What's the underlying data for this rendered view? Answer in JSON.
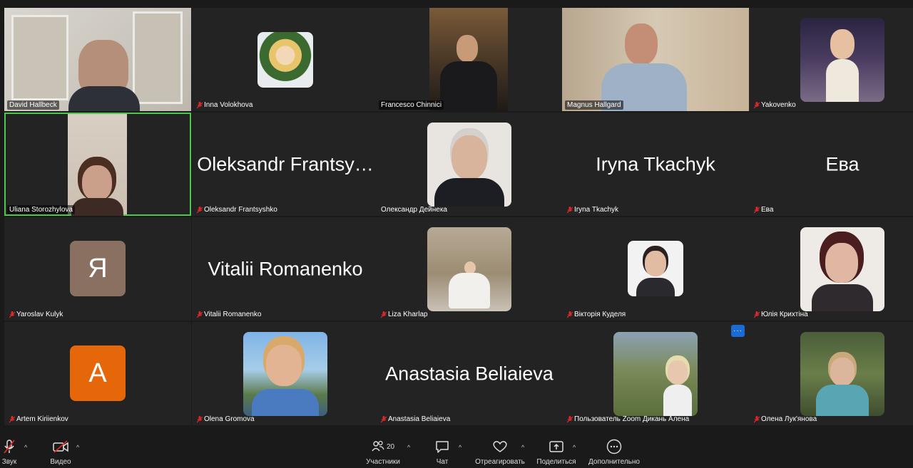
{
  "participants": [
    {
      "name": "David Hallbeck",
      "muted": false
    },
    {
      "name": "Inna Volokhova",
      "muted": true
    },
    {
      "name": "Francesco Chinnici",
      "muted": false
    },
    {
      "name": "Magnus Hallgard",
      "muted": false
    },
    {
      "name": "Yakovenko",
      "muted": true
    },
    {
      "name": "Uliana Storozhylova",
      "muted": false,
      "speaking": true
    },
    {
      "name": "Oleksandr Frantsyshko",
      "muted": true,
      "display": "Oleksandr Frantsy…"
    },
    {
      "name": "Олександр Дейнека",
      "muted": false
    },
    {
      "name": "Iryna Tkachyk",
      "muted": true,
      "display": "Iryna Tkachyk"
    },
    {
      "name": "Ева",
      "muted": true,
      "display": "Ева"
    },
    {
      "name": "Yaroslav Kulyk",
      "muted": true,
      "avatar_letter": "Я",
      "avatar_color": "#8a7060"
    },
    {
      "name": "Vitalii Romanenko",
      "muted": true,
      "display": "Vitalii Romanenko"
    },
    {
      "name": "Liza Kharlap",
      "muted": true
    },
    {
      "name": "Вікторія Куделя",
      "muted": true
    },
    {
      "name": "Юлія Крихтіна",
      "muted": true
    },
    {
      "name": "Artem Kiriienkov",
      "muted": true,
      "avatar_letter": "A",
      "avatar_color": "#e5670a"
    },
    {
      "name": "Olena Gromova",
      "muted": true
    },
    {
      "name": "Anastasia Beliaieva",
      "muted": true,
      "display": "Anastasia Beliaieva"
    },
    {
      "name": "Пользователь Zoom Дикань Алена",
      "muted": true
    },
    {
      "name": "Олена Лук'янова",
      "muted": true
    }
  ],
  "more_options_label": "···",
  "toolbar": {
    "audio_label": "Звук",
    "video_label": "Видео",
    "participants_label": "Участники",
    "participants_count": "20",
    "chat_label": "Чат",
    "react_label": "Отреагировать",
    "share_label": "Поделиться",
    "more_label": "Дополнительно",
    "caret": "^"
  },
  "colors": {
    "speaking_border": "#4cc94c",
    "muted_red": "#e02828",
    "tile_bg": "#232323",
    "accent_blue": "#1a6bd6"
  }
}
